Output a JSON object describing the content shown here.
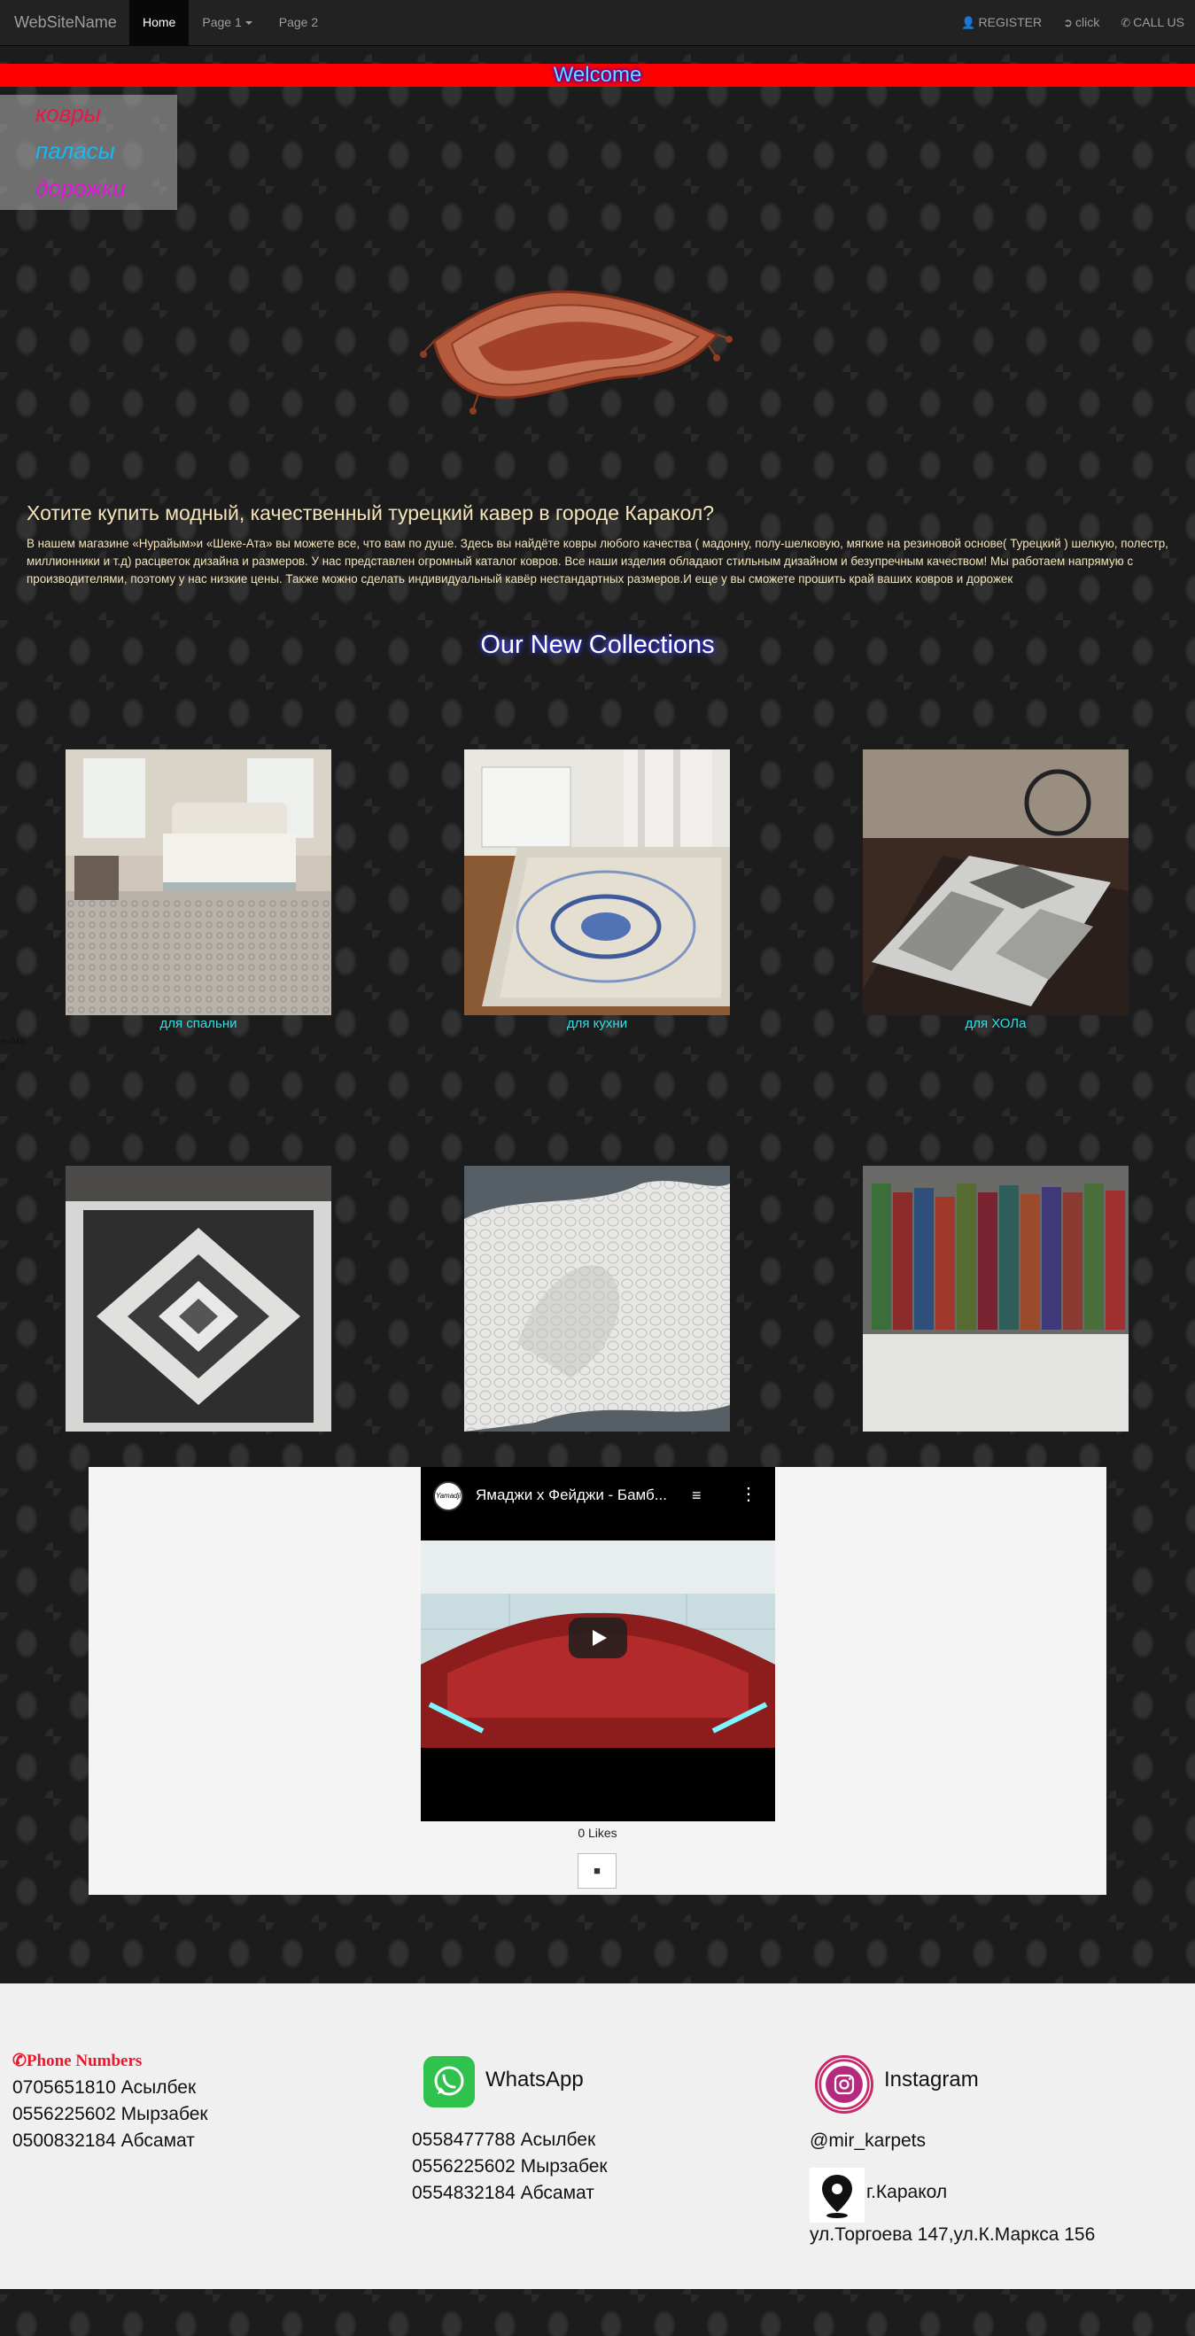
{
  "nav": {
    "brand": "WebSiteName",
    "items": [
      "Home",
      "Page 1",
      "Page 2"
    ],
    "register": "REGISTER",
    "click": "click",
    "call": "CALL US"
  },
  "welcome": "Welcome",
  "categories": [
    "ковры",
    "паласы",
    "дорожки"
  ],
  "intro": {
    "heading": "Хотите купить модный, качественный турецкий кавер в городе Каракол?",
    "paragraph": "В нашем магазине «Нурайым»и «Шеке-Ата» вы можете все, что вам по душе. Здесь вы найдёте ковры любого качества ( мадонну, полу-шелковую, мягкие на резиновой основе( Турецкий ) шелкую, полестр, миллионники и т.д) расцветок дизайна и размеров. У нас представлен огромный каталог ковров. Все наши изделия обладают стильным дизайном и безупречным качеством! Мы работаем напрямую с производителями, поэтому у нас низкие цены. Также можно сделать индивидуальный кавёр нестандартных размеров.И еще у вы сможете прошить край ваших ковров и дорожек"
  },
  "collections_title": "Our New Collections",
  "collection_labels": [
    "для спальни",
    "для кухни",
    "для ХОЛа"
  ],
  "stray_text": [
    "e-Ata",
    "a."
  ],
  "video": {
    "title": "Ямаджи х Фейджи - Бамб...",
    "logo_text": "Yamadji",
    "likes": "0 Likes",
    "like_button_glyph": "■"
  },
  "footer": {
    "phone_title": "Phone Numbers",
    "phones": [
      "0705651810 Асылбек",
      "0556225602 Мырзабек",
      "0500832184 Абсамат"
    ],
    "whatsapp_label": "WhatsApp",
    "whatsapp_numbers": [
      "0558477788 Асылбек",
      "0556225602 Мырзабек",
      "0554832184 Абсамат"
    ],
    "instagram_label": "Instagram",
    "instagram_handle": "@mir_karpets",
    "city": "г.Каракол",
    "address": "ул.Торгоева 147,ул.К.Маркса 156"
  },
  "colors": {
    "welcome_bar": "#ff0000",
    "label_cyan": "#2de0e6",
    "phone_red": "#e8172b",
    "whatsapp_green": "#2fc24c"
  }
}
